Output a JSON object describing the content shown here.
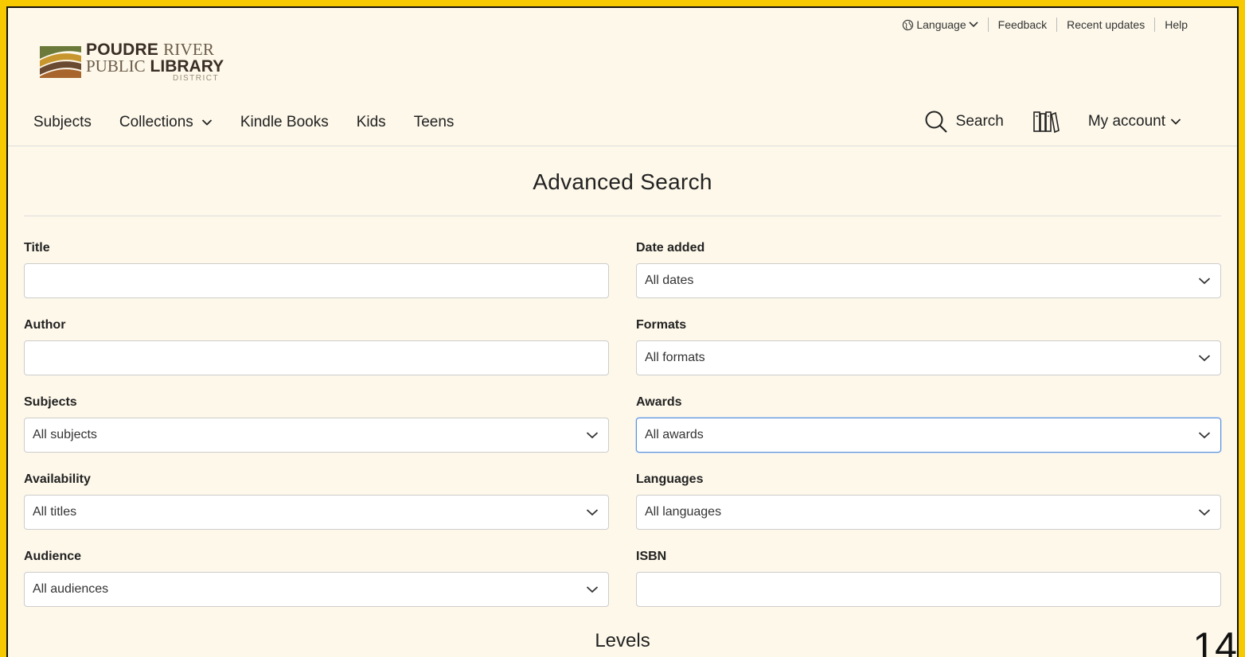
{
  "utility": {
    "language": "Language",
    "feedback": "Feedback",
    "recent_updates": "Recent updates",
    "help": "Help"
  },
  "logo": {
    "word1_bold": "POUDRE",
    "word1_light": "RIVER",
    "word2_light": "PUBLIC",
    "word2_bold": "LIBRARY",
    "word3": "DISTRICT"
  },
  "nav": {
    "subjects": "Subjects",
    "collections": "Collections",
    "kindle_books": "Kindle Books",
    "kids": "Kids",
    "teens": "Teens",
    "search": "Search",
    "my_account": "My account"
  },
  "page": {
    "title": "Advanced Search",
    "levels": "Levels"
  },
  "form": {
    "title": {
      "label": "Title",
      "value": ""
    },
    "date_added": {
      "label": "Date added",
      "value": "All dates"
    },
    "author": {
      "label": "Author",
      "value": ""
    },
    "formats": {
      "label": "Formats",
      "value": "All formats"
    },
    "subjects": {
      "label": "Subjects",
      "value": "All subjects"
    },
    "awards": {
      "label": "Awards",
      "value": "All awards"
    },
    "availability": {
      "label": "Availability",
      "value": "All titles"
    },
    "languages": {
      "label": "Languages",
      "value": "All languages"
    },
    "audience": {
      "label": "Audience",
      "value": "All audiences"
    },
    "isbn": {
      "label": "ISBN",
      "value": ""
    }
  },
  "overlay": {
    "corner_number": "14"
  },
  "colors": {
    "border": "#f7c900",
    "page_bg": "#fdf8ea",
    "focus": "#5b8fd6"
  }
}
